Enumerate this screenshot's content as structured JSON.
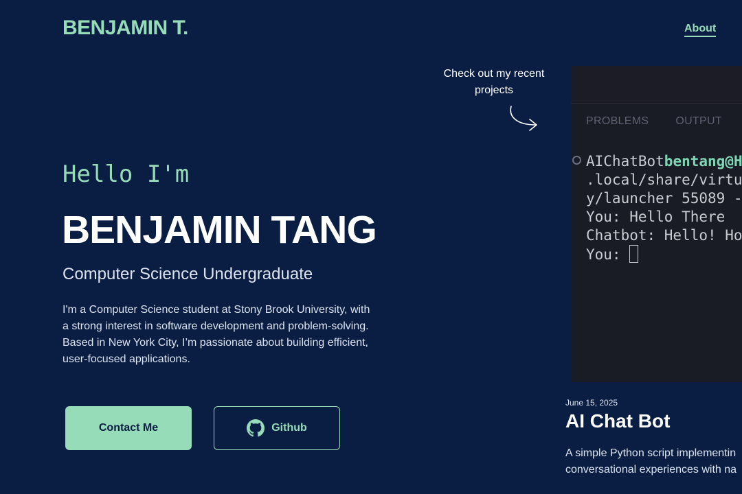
{
  "header": {
    "logo": "BENJAMIN T.",
    "nav": [
      {
        "label": "About"
      }
    ]
  },
  "hero": {
    "greeting": "Hello I'm",
    "name": "BENJAMIN TANG",
    "role": "Computer Science Undergraduate",
    "bio": "I'm a Computer Science student at Stony Brook University, with a strong interest in software development and problem-solving. Based in New York City, I’m passionate about building efficient, user-focused applications.",
    "buttons": {
      "contact_label": "Contact Me",
      "github_label": "Github"
    }
  },
  "callout": {
    "text": "Check out my recent projects"
  },
  "terminal": {
    "tabs": [
      "PROBLEMS",
      "OUTPUT"
    ],
    "lines": {
      "prompt_prefix": "AIChatBot",
      "prompt_user": "bentang@H",
      "line2": ".local/share/virtu",
      "line3": "y/launcher 55089 -",
      "line4": "You: Hello There",
      "line5": "Chatbot: Hello! Ho",
      "line6": "You: "
    }
  },
  "project": {
    "date": "June 15, 2025",
    "title": "AI Chat Bot",
    "description_line1": "A simple Python script implementin",
    "description_line2": "conversational experiences with na"
  },
  "colors": {
    "background": "#0a1e44",
    "accent": "#97dcb8",
    "terminal_bg": "#1a1c25"
  },
  "icons": {
    "github": "github-icon",
    "arrow": "curved-arrow-icon",
    "status": "circle-status-icon"
  }
}
